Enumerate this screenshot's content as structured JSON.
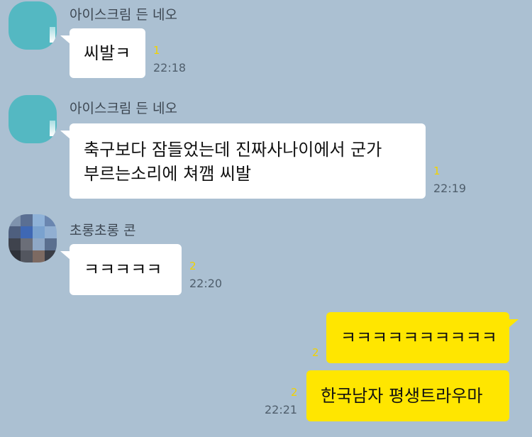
{
  "messages": [
    {
      "sender": "아이스크림 든 네오",
      "text": "씨발ㅋ",
      "unread": "1",
      "time": "22:18"
    },
    {
      "sender": "아이스크림 든 네오",
      "lines": [
        "축구보다 잠들었는데 진짜사나이에서 군가",
        "부르는소리에 쳐깸 씨발"
      ],
      "unread": "1",
      "time": "22:19"
    },
    {
      "sender": "초롱초롱 콘",
      "text": "ㅋㅋㅋㅋㅋ",
      "unread": "2",
      "time": "22:20"
    }
  ],
  "my_messages": [
    {
      "text": "ㅋㅋㅋㅋㅋㅋㅋㅋㅋㅋ",
      "unread": "2"
    },
    {
      "text": "한국남자 평생트라우마",
      "unread": "2",
      "time": "22:21"
    }
  ],
  "colors": {
    "background": "#abc0d2",
    "my_bubble": "#ffe600",
    "their_bubble": "#ffffff",
    "unread": "#f2d200"
  },
  "icons": {
    "avatar_neo": "profile-avatar",
    "avatar_con": "pixelated-profile-avatar"
  }
}
